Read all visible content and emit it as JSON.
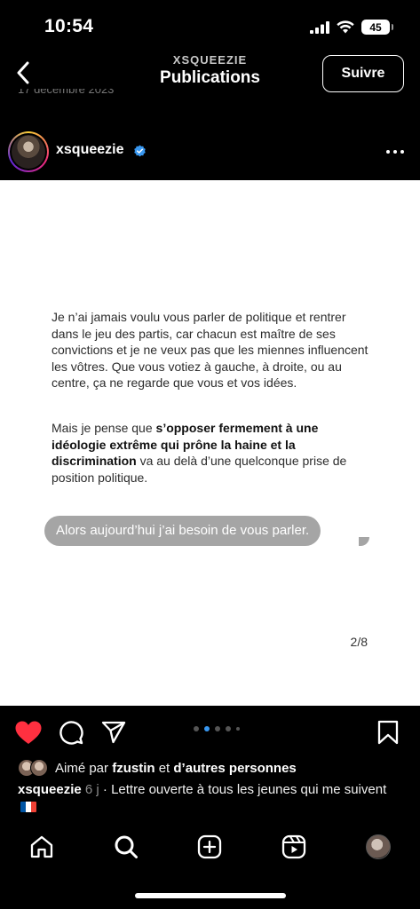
{
  "status": {
    "time": "10:54",
    "battery": "45"
  },
  "header": {
    "username": "XSQUEEZIE",
    "title": "Publications",
    "follow_label": "Suivre",
    "clipped_date": "17 décembre 2023"
  },
  "post": {
    "author": "xsqueezie",
    "letter": {
      "p1": "Je n’ai jamais voulu vous parler de politique et rentrer dans le jeu des partis, car chacun est maître de ses convictions et je ne veux pas que les miennes influencent les vôtres. Que vous votiez à gauche, à droite, ou au centre, ça ne regarde que vous et vos idées.",
      "p2_start": "Mais je pense que ",
      "p2_bold": "s’opposer fermement à une idéologie extrême qui prône la haine et la discrimination",
      "p2_end": " va au delà d’une quelconque prise de position politique.",
      "bubble": "Alors aujourd’hui j’ai besoin de vous parler.",
      "page": "2/8"
    },
    "likes": {
      "prefix": "Aimé par ",
      "user": "fzustin",
      "middle": " et ",
      "others": "d’autres personnes"
    },
    "caption": {
      "author": "xsqueezie",
      "ago": "6 j",
      "text": " · Lettre ouverte à tous les jeunes qui me suivent"
    }
  },
  "icons": {
    "back": "chevron-left-icon",
    "verified": "verified-badge-icon",
    "more": "more-options-icon",
    "like": "heart-icon",
    "comment": "comment-icon",
    "share": "send-icon",
    "save": "bookmark-icon",
    "home": "home-icon",
    "search": "search-icon",
    "create": "plus-square-icon",
    "reels": "reels-icon"
  },
  "colors": {
    "like": "#ff3040",
    "verified": "#3897f0",
    "carousel_active": "#3897f0",
    "bubble": "#a5a5a5"
  }
}
